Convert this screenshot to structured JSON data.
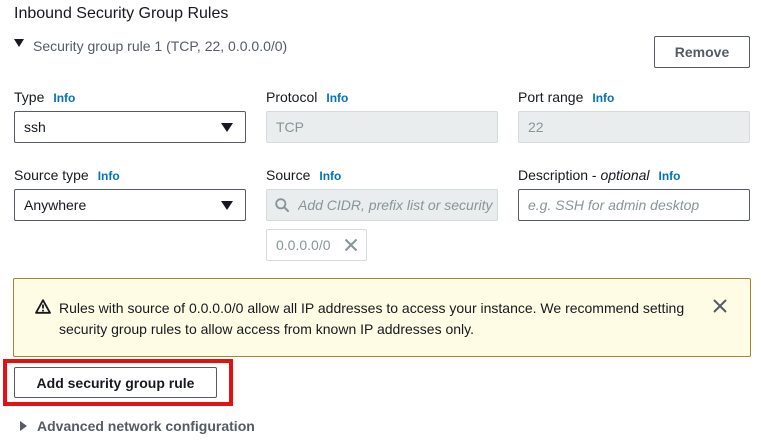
{
  "section": {
    "title": "Inbound Security Group Rules"
  },
  "rule": {
    "header_label": "Security group rule 1 (TCP, 22, 0.0.0.0/0)",
    "remove_label": "Remove",
    "type": {
      "label": "Type",
      "info": "Info",
      "value": "ssh"
    },
    "protocol": {
      "label": "Protocol",
      "info": "Info",
      "value": "TCP"
    },
    "port_range": {
      "label": "Port range",
      "info": "Info",
      "value": "22"
    },
    "source_type": {
      "label": "Source type",
      "info": "Info",
      "value": "Anywhere"
    },
    "source": {
      "label": "Source",
      "info": "Info",
      "placeholder": "Add CIDR, prefix list or security",
      "tokens": [
        "0.0.0.0/0"
      ]
    },
    "description": {
      "label": "Description - ",
      "label_optional": "optional",
      "info": "Info",
      "placeholder": "e.g. SSH for admin desktop"
    }
  },
  "alert": {
    "message": "Rules with source of 0.0.0.0/0 allow all IP addresses to access your instance. We recommend setting security group rules to allow access from known IP addresses only."
  },
  "actions": {
    "add_rule_label": "Add security group rule"
  },
  "advanced": {
    "label": "Advanced network configuration"
  },
  "icons": {
    "caret": "caret-down-icon",
    "warning": "warning-icon",
    "close": "close-icon",
    "search": "search-icon",
    "expand": "caret-right-icon"
  },
  "colors": {
    "link": "#0073bb",
    "alert_bg": "#fffce6",
    "alert_border": "#a4862c",
    "highlight": "#e31212"
  }
}
